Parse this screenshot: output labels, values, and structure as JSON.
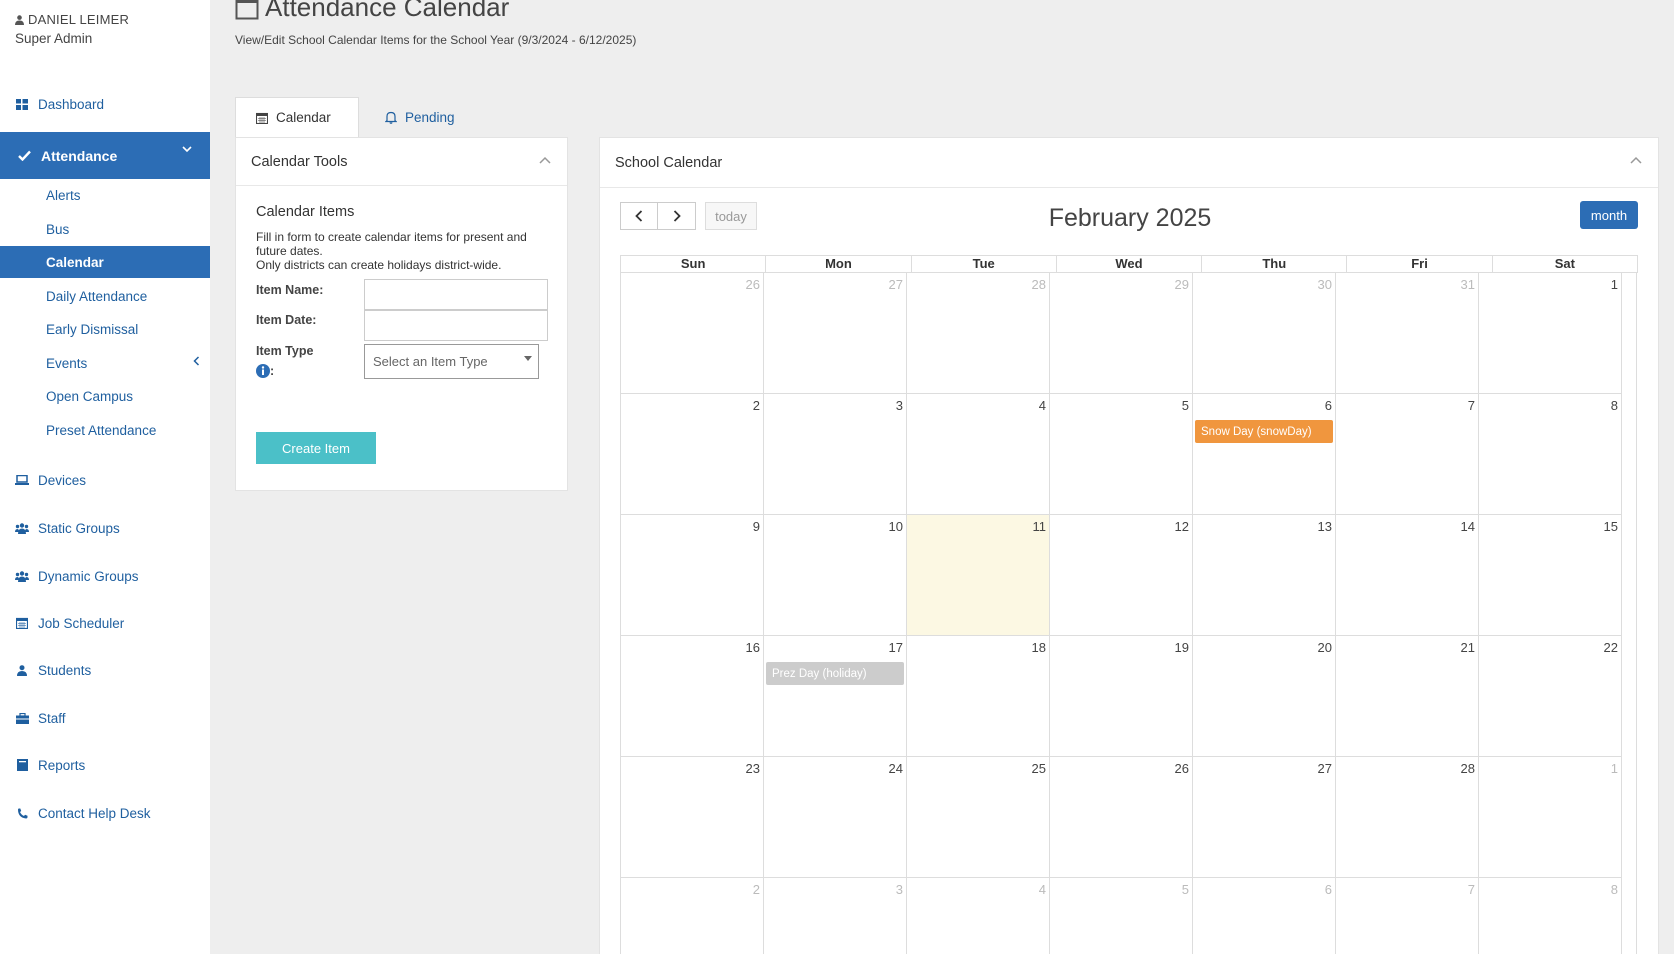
{
  "user": {
    "name": "DANIEL LEIMER",
    "role": "Super Admin"
  },
  "sidebar": {
    "dashboard": "Dashboard",
    "attendance": "Attendance",
    "attendance_items": [
      "Alerts",
      "Bus",
      "Calendar",
      "Daily Attendance",
      "Early Dismissal",
      "Events",
      "Open Campus",
      "Preset Attendance"
    ],
    "active_sub": "Calendar",
    "lower_items": [
      "Devices",
      "Static Groups",
      "Dynamic Groups",
      "Job Scheduler",
      "Students",
      "Staff",
      "Reports",
      "Contact Help Desk"
    ]
  },
  "header": {
    "title": "Attendance Calendar",
    "subtitle": "View/Edit School Calendar Items for the School Year (9/3/2024 - 6/12/2025)"
  },
  "tabs": [
    {
      "label": "Calendar",
      "icon": "calendar-icon",
      "active": true
    },
    {
      "label": "Pending",
      "icon": "bell-icon",
      "active": false
    }
  ],
  "tools": {
    "title": "Calendar Tools",
    "section_title": "Calendar Items",
    "desc_line1": "Fill in form to create calendar items for present and future dates.",
    "desc_line2": "Only districts can create holidays district-wide.",
    "item_name_label": "Item Name:",
    "item_name_value": "",
    "item_date_label": "Item Date:",
    "item_date_value": "",
    "item_type_label": "Item Type",
    "item_type_colon": ":",
    "item_type_placeholder": "Select an Item Type",
    "create_label": "Create Item"
  },
  "calendar": {
    "panel_title": "School Calendar",
    "month_title": "February 2025",
    "today_label": "today",
    "view_label": "month",
    "days_of_week": [
      "Sun",
      "Mon",
      "Tue",
      "Wed",
      "Thu",
      "Fri",
      "Sat"
    ],
    "weeks": [
      [
        {
          "d": "26",
          "other": true
        },
        {
          "d": "27",
          "other": true
        },
        {
          "d": "28",
          "other": true
        },
        {
          "d": "29",
          "other": true
        },
        {
          "d": "30",
          "other": true
        },
        {
          "d": "31",
          "other": true
        },
        {
          "d": "1"
        }
      ],
      [
        {
          "d": "2"
        },
        {
          "d": "3"
        },
        {
          "d": "4"
        },
        {
          "d": "5"
        },
        {
          "d": "6",
          "event": "Snow Day (snowDay)",
          "event_type": "snow"
        },
        {
          "d": "7"
        },
        {
          "d": "8"
        }
      ],
      [
        {
          "d": "9"
        },
        {
          "d": "10"
        },
        {
          "d": "11",
          "today": true
        },
        {
          "d": "12"
        },
        {
          "d": "13"
        },
        {
          "d": "14"
        },
        {
          "d": "15"
        }
      ],
      [
        {
          "d": "16"
        },
        {
          "d": "17",
          "event": "Prez Day (holiday)",
          "event_type": "holiday"
        },
        {
          "d": "18"
        },
        {
          "d": "19"
        },
        {
          "d": "20"
        },
        {
          "d": "21"
        },
        {
          "d": "22"
        }
      ],
      [
        {
          "d": "23"
        },
        {
          "d": "24"
        },
        {
          "d": "25"
        },
        {
          "d": "26"
        },
        {
          "d": "27"
        },
        {
          "d": "28"
        },
        {
          "d": "1",
          "other": true
        }
      ],
      [
        {
          "d": "2",
          "other": true
        },
        {
          "d": "3",
          "other": true
        },
        {
          "d": "4",
          "other": true
        },
        {
          "d": "5",
          "other": true
        },
        {
          "d": "6",
          "other": true
        },
        {
          "d": "7",
          "other": true
        },
        {
          "d": "8",
          "other": true
        }
      ]
    ]
  },
  "colors": {
    "primary": "#2c6db5",
    "link": "#1f5f9f",
    "create_button": "#4bc0c8",
    "snow_event": "#f0963e",
    "holiday_event": "#cccccc",
    "today_cell": "#fcf8e3"
  }
}
